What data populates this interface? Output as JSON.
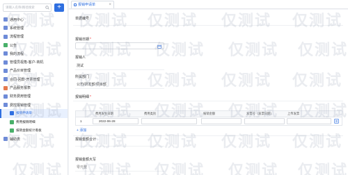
{
  "sidebar": {
    "search_placeholder": "请输入名称/路径搜索",
    "add_label": "+",
    "items": [
      {
        "label": "通用中心",
        "level": 0,
        "color": "#6e8bd8"
      },
      {
        "label": "系统管理",
        "level": 0,
        "color": "#6e8bd8"
      },
      {
        "label": "流程管理",
        "level": 0,
        "color": "#6e8bd8"
      },
      {
        "label": "公告",
        "level": 0,
        "color": "#49b06a"
      },
      {
        "label": "我的流程",
        "level": 0,
        "color": "#6e8bd8"
      },
      {
        "label": "管理员视角-客户-商机",
        "level": 0,
        "color": "#6e8bd8"
      },
      {
        "label": "产品价目管理",
        "level": 0,
        "color": "#6e8bd8"
      },
      {
        "label": "合同-回款-开票管理",
        "level": 0,
        "color": "#6e8bd8"
      },
      {
        "label": "产品服务报表",
        "level": 0,
        "color": "#e47a4f"
      },
      {
        "label": "财务费用管理",
        "level": 0,
        "color": "#6e8bd8"
      },
      {
        "label": "费控报销管理",
        "level": 0,
        "color": "#6e8bd8"
      },
      {
        "label": "报销申请单",
        "level": 1,
        "color": "#2f6fe0",
        "active": true
      },
      {
        "label": "费用报销明细",
        "level": 1,
        "color": "#49b06a"
      },
      {
        "label": "报销金额统计看板",
        "level": 1,
        "color": "#49b06a"
      },
      {
        "label": "辅助表",
        "level": 0,
        "color": "#6e8bd8"
      }
    ]
  },
  "tabbar": {
    "tab_label": "报销申请单",
    "close_label": "×"
  },
  "form": {
    "doc_no_label": "单据编号",
    "date_label": "报销日期",
    "applicant_label": "报销人",
    "applicant_value": "测试",
    "dept_label": "所属部门",
    "dept_value": "公司/研发部/项目部",
    "detail_label": "报销明细",
    "total_label": "报销金额合计",
    "upper_label": "报销金额大写",
    "upper_value": "零元整",
    "table": {
      "headers": [
        "费用发生日期",
        "费用类别",
        "报销金额",
        "发票号（发票日期）",
        "上传发票"
      ],
      "rows": [
        {
          "index": "1",
          "date": "2022-06-28"
        }
      ],
      "add_label": "添加"
    }
  },
  "watermark": "仅测试"
}
